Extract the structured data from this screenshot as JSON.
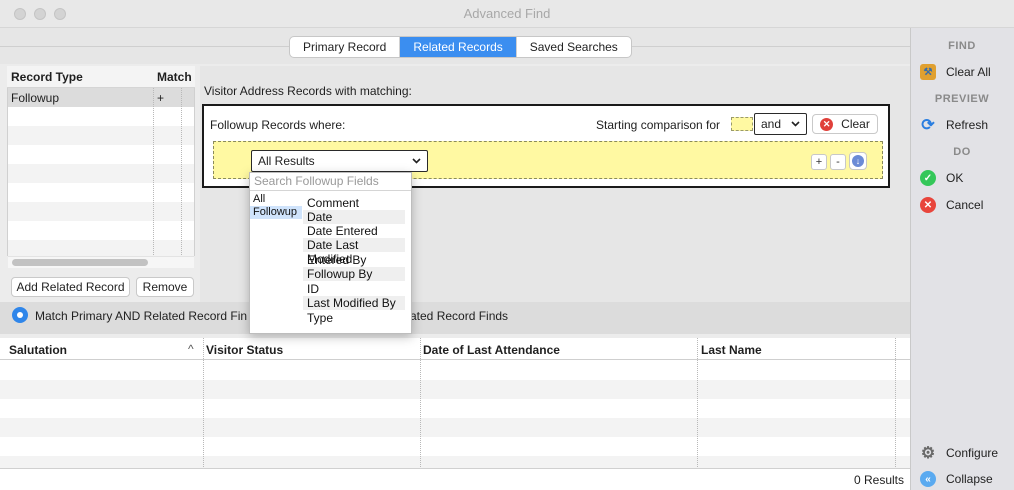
{
  "window": {
    "title": "Advanced Find"
  },
  "tabs": [
    {
      "label": "Primary Record",
      "active": false
    },
    {
      "label": "Related Records",
      "active": true
    },
    {
      "label": "Saved Searches",
      "active": false
    }
  ],
  "related_list": {
    "headers": {
      "record_type": "Record Type",
      "match": "Match"
    },
    "rows": [
      {
        "record_type": "Followup",
        "match": "+"
      }
    ],
    "add_button": "Add Related Record",
    "remove_button": "Remove"
  },
  "criteria": {
    "section_label": "Visitor Address Records with matching:",
    "group_label": "Followup Records where:",
    "starting_comparison_label": "Starting comparison for",
    "conjunction": "and",
    "clear_label": "Clear",
    "field_select": "All Results",
    "add_label": "+",
    "remove_label": "-"
  },
  "dropdown": {
    "search_placeholder": "Search Followup Fields",
    "categories": [
      "All",
      "Followup"
    ],
    "selected_category": "Followup",
    "fields": [
      "Comment",
      "Date",
      "Date Entered",
      "Date Last Modified",
      "Entered By",
      "Followup By",
      "ID",
      "Last Modified By",
      "Type"
    ]
  },
  "match_option": {
    "label_left": "Match Primary AND Related Record Fin",
    "label_right": "ated Record Finds"
  },
  "results_table": {
    "columns": [
      "Salutation",
      "Visitor Status",
      "Date of Last Attendance",
      "Last Name"
    ],
    "sort_indicator": "^",
    "rows": []
  },
  "status": {
    "results": "0 Results"
  },
  "sidebar": {
    "find_heading": "FIND",
    "clear_all": "Clear All",
    "preview_heading": "PREVIEW",
    "refresh": "Refresh",
    "do_heading": "DO",
    "ok": "OK",
    "cancel": "Cancel",
    "configure": "Configure",
    "collapse": "Collapse"
  },
  "colors": {
    "accent": "#3b8ef0",
    "criteria_highlight": "#fff9a2",
    "ok_green": "#34c759",
    "cancel_red": "#e8453c"
  }
}
